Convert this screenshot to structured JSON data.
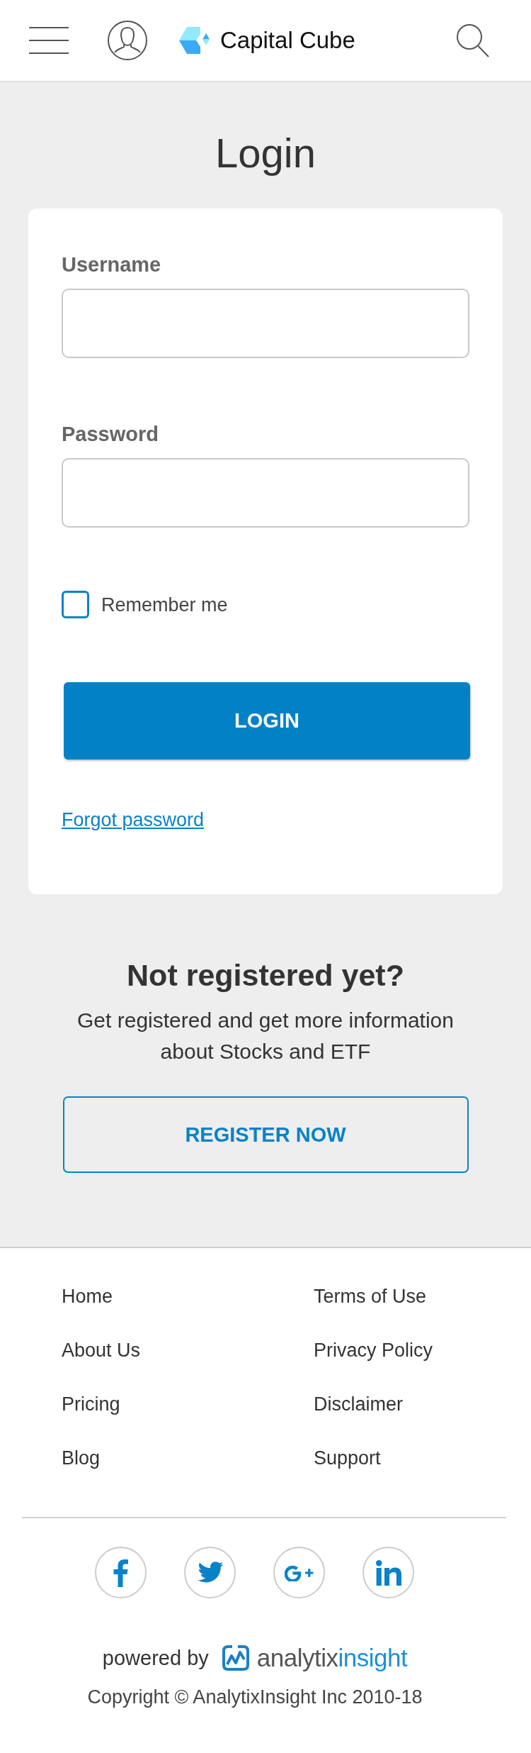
{
  "header": {
    "brand": "Capital Cube"
  },
  "login": {
    "title": "Login",
    "fields": [
      {
        "label": "Username"
      },
      {
        "label": "Password"
      }
    ],
    "remember": {
      "label": "Remember me",
      "checked": false
    },
    "submit": "LOGIN",
    "forgot_link": "Forgot password"
  },
  "register": {
    "heading": "Not registered yet?",
    "text": "Get registered and get more information about Stocks and ETF",
    "button": "REGISTER NOW"
  },
  "footer": {
    "links": [
      {
        "label": "Home"
      },
      {
        "label": "Terms of Use"
      },
      {
        "label": "About Us"
      },
      {
        "label": "Privacy Policy"
      },
      {
        "label": "Pricing"
      },
      {
        "label": "Disclaimer"
      },
      {
        "label": "Blog"
      },
      {
        "label": "Support"
      }
    ],
    "social_links": [
      {
        "kind": "facebook"
      },
      {
        "kind": "twitter"
      },
      {
        "kind": "google_plus"
      },
      {
        "kind": "linkedin"
      }
    ],
    "powered_by": {
      "label": "powered by",
      "brand": [
        "analytix",
        "insight"
      ]
    },
    "copyright": "Copyright © AnalytixInsight Inc 2010-18"
  }
}
